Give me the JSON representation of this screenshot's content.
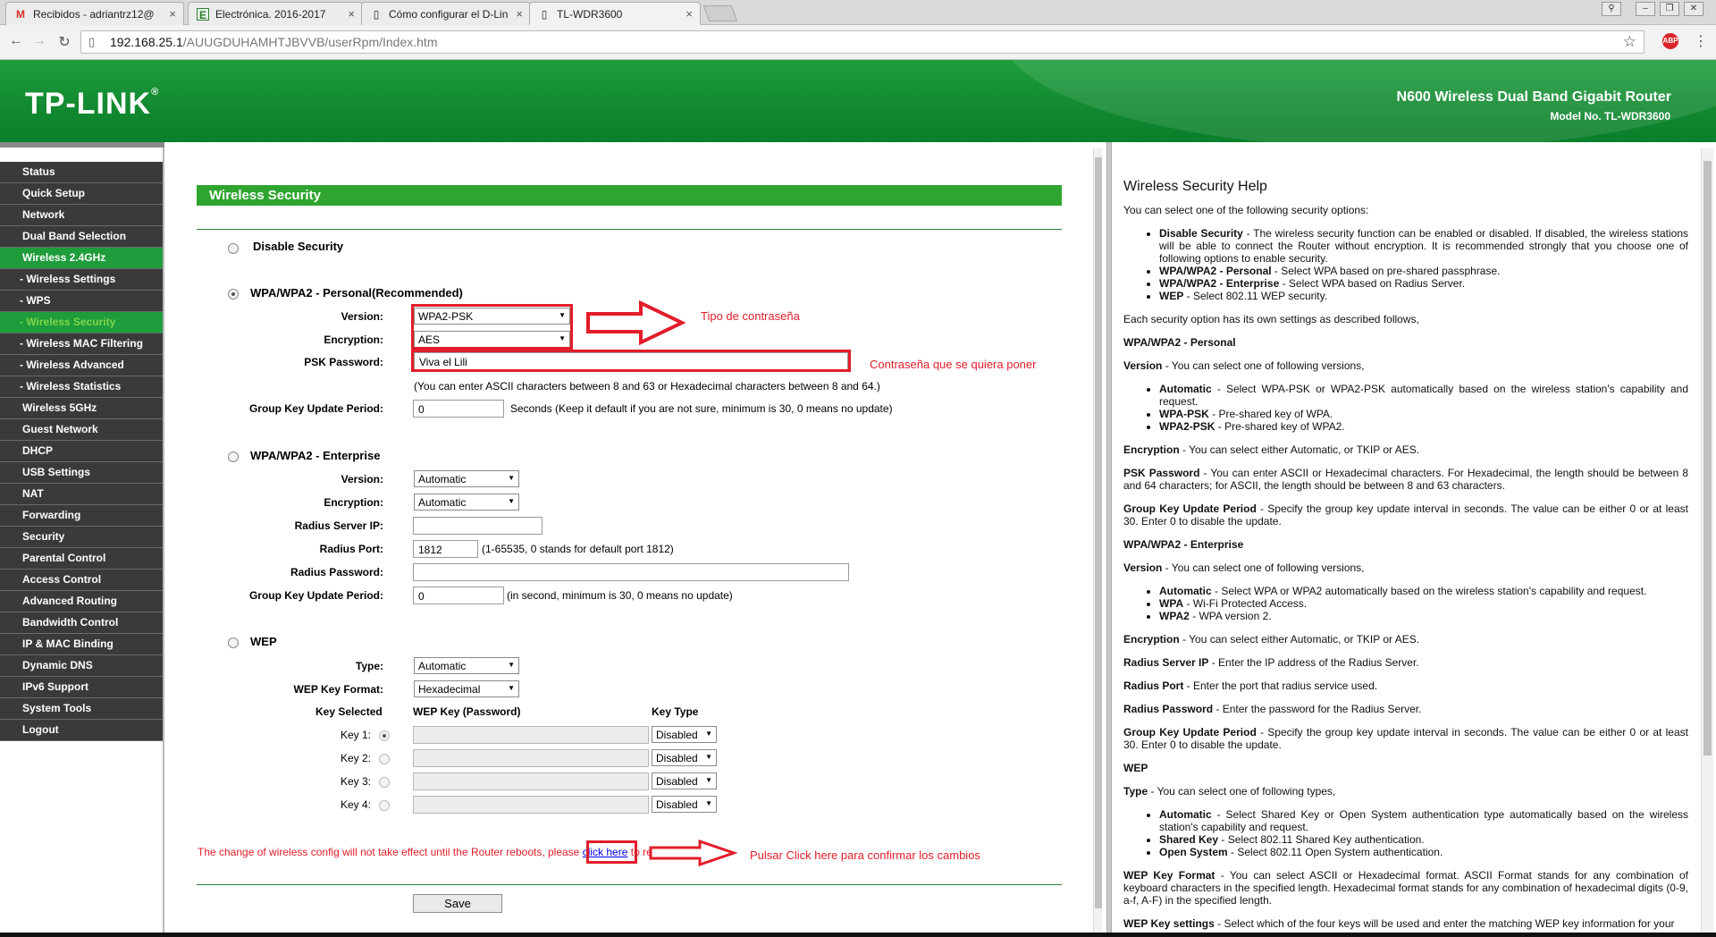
{
  "browser": {
    "tabs": [
      {
        "title": "Recibidos - adriantrz12@",
        "icon": "gmail-icon",
        "glyph": "M",
        "color": "#d93025"
      },
      {
        "title": "Electrónica. 2016-2017",
        "icon": "elearning-icon",
        "glyph": "E",
        "color": "#2e7d32"
      },
      {
        "title": "Cómo configurar el D-Lin",
        "icon": "page-icon",
        "glyph": "▯",
        "color": "#555555"
      },
      {
        "title": "TL-WDR3600",
        "icon": "page-icon",
        "glyph": "▯",
        "color": "#555555"
      }
    ],
    "close_glyph": "×",
    "url_host": "192.168.25.1",
    "url_path": "/AUUGDUHAMHTJBVVB/userRpm/Index.htm",
    "back_glyph": "←",
    "forward_glyph": "→",
    "reload_glyph": "↻",
    "star_glyph": "☆",
    "abp_label": "ABP",
    "menu_glyph": "⋮",
    "win_user_glyph": "⚲",
    "win_min_glyph": "–",
    "win_max_glyph": "❐",
    "win_close_glyph": "✕"
  },
  "header": {
    "logo": "TP-LINK",
    "logo_mark": "®",
    "product": "N600 Wireless Dual Band Gigabit Router",
    "model": "Model No. TL-WDR3600"
  },
  "menu": [
    {
      "label": "Status",
      "sub": false,
      "active": false
    },
    {
      "label": "Quick Setup",
      "sub": false,
      "active": false
    },
    {
      "label": "Network",
      "sub": false,
      "active": false
    },
    {
      "label": "Dual Band Selection",
      "sub": false,
      "active": false
    },
    {
      "label": "Wireless 2.4GHz",
      "sub": false,
      "active": true
    },
    {
      "label": "- Wireless Settings",
      "sub": true,
      "active": false
    },
    {
      "label": "- WPS",
      "sub": true,
      "active": false
    },
    {
      "label": "- Wireless Security",
      "sub": true,
      "active": true
    },
    {
      "label": "- Wireless MAC Filtering",
      "sub": true,
      "active": false
    },
    {
      "label": "- Wireless Advanced",
      "sub": true,
      "active": false
    },
    {
      "label": "- Wireless Statistics",
      "sub": true,
      "active": false
    },
    {
      "label": "Wireless 5GHz",
      "sub": false,
      "active": false
    },
    {
      "label": "Guest Network",
      "sub": false,
      "active": false
    },
    {
      "label": "DHCP",
      "sub": false,
      "active": false
    },
    {
      "label": "USB Settings",
      "sub": false,
      "active": false
    },
    {
      "label": "NAT",
      "sub": false,
      "active": false
    },
    {
      "label": "Forwarding",
      "sub": false,
      "active": false
    },
    {
      "label": "Security",
      "sub": false,
      "active": false
    },
    {
      "label": "Parental Control",
      "sub": false,
      "active": false
    },
    {
      "label": "Access Control",
      "sub": false,
      "active": false
    },
    {
      "label": "Advanced Routing",
      "sub": false,
      "active": false
    },
    {
      "label": "Bandwidth Control",
      "sub": false,
      "active": false
    },
    {
      "label": "IP & MAC Binding",
      "sub": false,
      "active": false
    },
    {
      "label": "Dynamic DNS",
      "sub": false,
      "active": false
    },
    {
      "label": "IPv6 Support",
      "sub": false,
      "active": false
    },
    {
      "label": "System Tools",
      "sub": false,
      "active": false
    },
    {
      "label": "Logout",
      "sub": false,
      "active": false
    }
  ],
  "main": {
    "title": "Wireless Security",
    "disable": {
      "label": "Disable Security"
    },
    "personal": {
      "label": "WPA/WPA2 - Personal(Recommended)",
      "version_label": "Version:",
      "version": "WPA2-PSK",
      "encryption_label": "Encryption:",
      "encryption": "AES",
      "psk_label": "PSK Password:",
      "psk": "Viva el Lili",
      "psk_hint": "(You can enter ASCII characters between 8 and 63 or Hexadecimal characters between 8 and 64.)",
      "gk_label": "Group Key Update Period:",
      "gk": "0",
      "gk_hint": "Seconds (Keep it default if you are not sure, minimum is 30, 0 means no update)"
    },
    "enterprise": {
      "label": "WPA/WPA2 - Enterprise",
      "version_label": "Version:",
      "version": "Automatic",
      "encryption_label": "Encryption:",
      "encryption": "Automatic",
      "radius_ip_label": "Radius Server IP:",
      "radius_ip": "",
      "radius_port_label": "Radius Port:",
      "radius_port": "1812",
      "radius_port_hint": "(1-65535, 0 stands for default port 1812)",
      "radius_pw_label": "Radius Password:",
      "radius_pw": "",
      "gk_label": "Group Key Update Period:",
      "gk": "0",
      "gk_hint": "(in second, minimum is 30, 0 means no update)"
    },
    "wep": {
      "label": "WEP",
      "type_label": "Type:",
      "type": "Automatic",
      "format_label": "WEP Key Format:",
      "format": "Hexadecimal",
      "col_selected": "Key Selected",
      "col_key": "WEP Key (Password)",
      "col_type": "Key Type",
      "keys": [
        {
          "label": "Key 1:",
          "type": "Disabled"
        },
        {
          "label": "Key 2:",
          "type": "Disabled"
        },
        {
          "label": "Key 3:",
          "type": "Disabled"
        },
        {
          "label": "Key 4:",
          "type": "Disabled"
        }
      ]
    },
    "reboot_text": "The change of wireless config will not take effect until the Router reboots, please",
    "reboot_link": "click here",
    "reboot_tail": "to reboot",
    "save": "Save",
    "dropdown_glyph": "▼"
  },
  "annotations": {
    "type": "Tipo de contraseña",
    "password": "Contraseña que se quiera poner",
    "confirm": "Pulsar Click here para confirmar los cambios"
  },
  "help": {
    "title": "Wireless Security Help",
    "intro": "You can select one of the following security options:",
    "options": [
      {
        "term": "Disable Security",
        "desc": " - The wireless security function can be enabled or disabled. If disabled, the wireless stations will be able to connect the Router without encryption. It is recommended strongly that you choose one of following options to enable security."
      },
      {
        "term": "WPA/WPA2 - Personal",
        "desc": " - Select WPA based on pre-shared passphrase."
      },
      {
        "term": "WPA/WPA2 - Enterprise",
        "desc": " - Select WPA based on Radius Server."
      },
      {
        "term": "WEP",
        "desc": " - Select 802.11 WEP security."
      }
    ],
    "each": "Each security option has its own settings as described follows,",
    "personal_head": "WPA/WPA2 - Personal",
    "version_term": "Version",
    "version_desc": " - You can select one of following versions,",
    "personal_versions": [
      {
        "term": "Automatic",
        "desc": " - Select WPA-PSK or WPA2-PSK automatically based on the wireless station's capability and request."
      },
      {
        "term": "WPA-PSK",
        "desc": " - Pre-shared key of WPA."
      },
      {
        "term": "WPA2-PSK",
        "desc": " - Pre-shared key of WPA2."
      }
    ],
    "encryption_term": "Encryption",
    "encryption_desc": " - You can select either Automatic, or TKIP or AES.",
    "psk_term": "PSK Password",
    "psk_desc": " - You can enter ASCII or Hexadecimal characters. For Hexadecimal, the length should be between 8 and 64 characters; for ASCII, the length should be between 8 and 63 characters.",
    "gk_term": "Group Key Update Period",
    "gk_desc": " - Specify the group key update interval in seconds. The value can be either 0 or at least 30. Enter 0 to disable the update.",
    "enterprise_head": "WPA/WPA2 - Enterprise",
    "enterprise_versions": [
      {
        "term": "Automatic",
        "desc": " - Select WPA or WPA2 automatically based on the wireless station's capability and request."
      },
      {
        "term": "WPA",
        "desc": " - Wi-Fi Protected Access."
      },
      {
        "term": "WPA2",
        "desc": " - WPA version 2."
      }
    ],
    "radius_ip_term": "Radius Server IP",
    "radius_ip_desc": " - Enter the IP address of the Radius Server.",
    "radius_port_term": "Radius Port",
    "radius_port_desc": " - Enter the port that radius service used.",
    "radius_pw_term": "Radius Password",
    "radius_pw_desc": " - Enter the password for the Radius Server.",
    "wep_head": "WEP",
    "type_term": "Type",
    "type_desc": " - You can select one of following types,",
    "wep_types": [
      {
        "term": "Automatic",
        "desc": " - Select Shared Key or Open System authentication type automatically based on the wireless station's capability and request."
      },
      {
        "term": "Shared Key",
        "desc": " - Select 802.11 Shared Key authentication."
      },
      {
        "term": "Open System",
        "desc": " - Select 802.11 Open System authentication."
      }
    ],
    "format_term": "WEP Key Format",
    "format_desc": " - You can select ASCII or Hexadecimal format. ASCII Format stands for any combination of keyboard characters in the specified length. Hexadecimal format stands for any combination of hexadecimal digits (0-9, a-f, A-F) in the specified length.",
    "keysettings_term": "WEP Key settings",
    "keysettings_desc": " - Select which of the four keys will be used and enter the matching WEP key information for your"
  }
}
